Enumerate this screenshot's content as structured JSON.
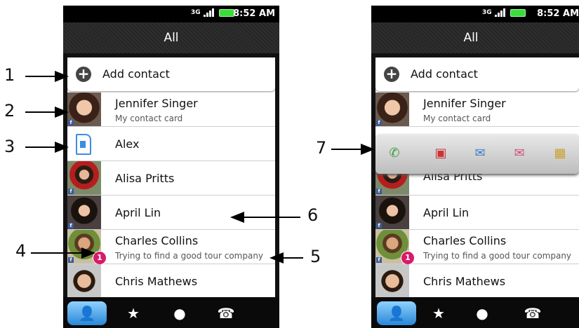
{
  "status": {
    "network": "3G",
    "time": "8:52 AM"
  },
  "header": {
    "title": "All"
  },
  "add_contact": {
    "label": "Add contact"
  },
  "contacts": [
    {
      "name": "Jennifer Singer",
      "sub": "My contact card"
    },
    {
      "name": "Alex"
    },
    {
      "name": "Alisa Pritts"
    },
    {
      "name": "April Lin"
    },
    {
      "name": "Charles  Collins",
      "sub": "Trying to find a good tour company",
      "badge": "1"
    },
    {
      "name": "Chris Mathews"
    }
  ],
  "tabs": [
    {
      "icon": "person-icon"
    },
    {
      "icon": "favorites-icon"
    },
    {
      "icon": "globe-icon"
    },
    {
      "icon": "call-history-icon"
    }
  ],
  "quick_actions": [
    {
      "icon": "call-icon"
    },
    {
      "icon": "contact-card-icon"
    },
    {
      "icon": "message-icon"
    },
    {
      "icon": "email-icon"
    },
    {
      "icon": "map-icon"
    }
  ],
  "callouts": [
    "1",
    "2",
    "3",
    "4",
    "5",
    "6",
    "7"
  ],
  "colors": {
    "accent": "#2a87d6",
    "badge": "#d81a6b",
    "facebook": "#3b5998"
  }
}
